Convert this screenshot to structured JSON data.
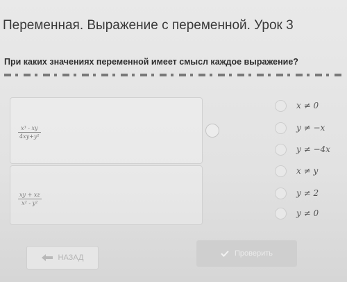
{
  "header": {
    "title": "Переменная. Выражение с переменной. Урок 3"
  },
  "task": {
    "question": "При каких значениях переменной имеет смысл каждое выражение?"
  },
  "expressions": [
    {
      "numerator": "x³ - xy",
      "denominator": "4xy+y²"
    },
    {
      "numerator": "xy + xz",
      "denominator": "x² - y²"
    }
  ],
  "options": [
    {
      "label": "x ≠ 0"
    },
    {
      "label": "y ≠ −x"
    },
    {
      "label": "y ≠ −4x"
    },
    {
      "label": "x ≠ y"
    },
    {
      "label": "y ≠ 2"
    },
    {
      "label": "y ≠ 0"
    }
  ],
  "buttons": {
    "back_label": "НАЗАД",
    "back_icon": "arrow-left-icon",
    "check_label": "Проверить",
    "check_icon": "check-icon"
  }
}
